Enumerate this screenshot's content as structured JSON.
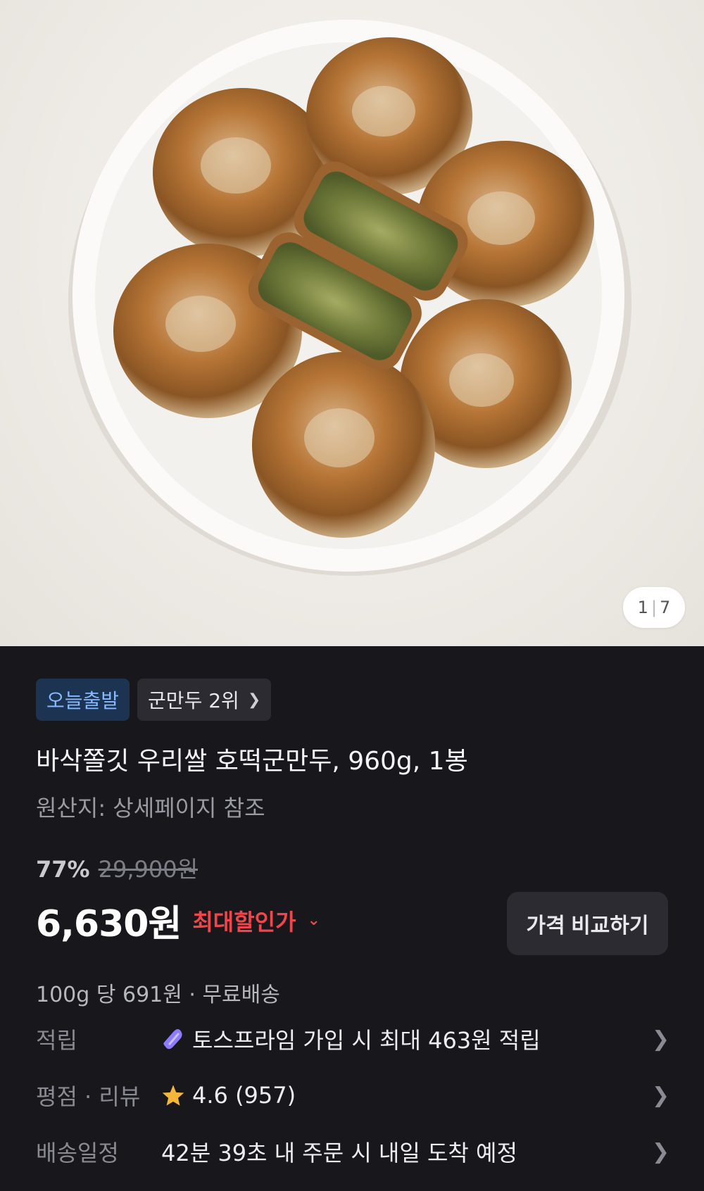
{
  "gallery": {
    "current": "1",
    "total": "7"
  },
  "badges": {
    "today_departure": "오늘출발",
    "ranking": "군만두 2위"
  },
  "product": {
    "title": "바삭쫄깃 우리쌀 호떡군만두, 960g, 1봉",
    "origin": "원산지: 상세페이지 참조"
  },
  "pricing": {
    "discount_rate": "77%",
    "original_price": "29,900원",
    "sale_price": "6,630원",
    "max_discount_label": "최대할인가",
    "compare_button": "가격 비교하기",
    "unit_price_and_shipping": "100g 당 691원 · 무료배송"
  },
  "details": {
    "points_label": "적립",
    "points_value": "토스프라임 가입 시 최대 463원 적립",
    "rating_label": "평점 · 리뷰",
    "rating_value": "4.6 (957)",
    "delivery_label": "배송일정",
    "delivery_value": "42분 39초 내 주문 시 내일 도착 예정"
  },
  "colors": {
    "accent_red": "#f0464b",
    "badge_blue": "#86b9ff",
    "star": "#f5b53b"
  }
}
